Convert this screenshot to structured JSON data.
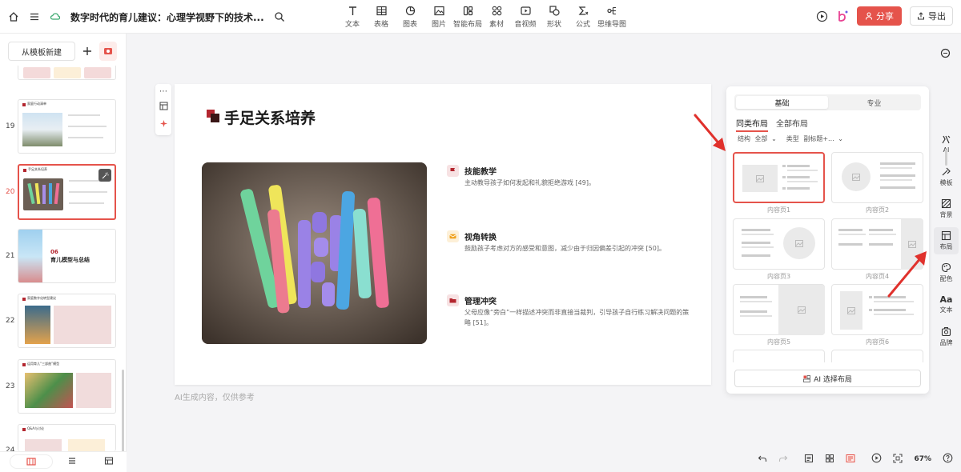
{
  "header": {
    "doc_title": "数字时代的育儿建议：心理学视野下的技术...",
    "share_label": "分享",
    "export_label": "导出"
  },
  "toolbar": [
    {
      "label": "文本",
      "icon": "text-icon"
    },
    {
      "label": "表格",
      "icon": "table-icon"
    },
    {
      "label": "图表",
      "icon": "chart-icon"
    },
    {
      "label": "图片",
      "icon": "image-icon"
    },
    {
      "label": "智能布局",
      "icon": "smart-layout-icon"
    },
    {
      "label": "素材",
      "icon": "material-icon"
    },
    {
      "label": "音视频",
      "icon": "video-icon"
    },
    {
      "label": "形状",
      "icon": "shape-icon"
    },
    {
      "label": "公式",
      "icon": "formula-icon"
    },
    {
      "label": "思维导图",
      "icon": "mindmap-icon"
    }
  ],
  "left_panel": {
    "template_button": "从模板新建",
    "slides": [
      {
        "number": "19",
        "title": "家庭行动清单"
      },
      {
        "number": "20",
        "title": "手足关系培养"
      },
      {
        "number": "21",
        "section": "06",
        "title": "育儿模型与总结"
      },
      {
        "number": "22",
        "title": "家庭数字化转型建议"
      },
      {
        "number": "23",
        "title": "运用育儿“三部曲”模型"
      },
      {
        "number": "24",
        "title": "Q&A与讨论"
      }
    ]
  },
  "slide": {
    "title": "手足关系培养",
    "points": [
      {
        "title": "技能教学",
        "desc": "主动教导孩子如何发起和礼貌拒绝游戏 [49]。",
        "color": "#b3262f"
      },
      {
        "title": "视角转换",
        "desc": "鼓励孩子考虑对方的感受和意图，减少由于归因偏差引起的冲突 [50]。",
        "color": "#f0a21f"
      },
      {
        "title": "管理冲突",
        "desc": "父母应像“旁白”一样描述冲突而非直接当裁判，引导孩子自行练习解决问题的策略 [51]。",
        "color": "#b3262f"
      }
    ],
    "ai_note": "AI生成内容，仅供参考"
  },
  "layout_panel": {
    "segments": [
      "基础",
      "专业"
    ],
    "subtabs": [
      "同类布局",
      "全部布局"
    ],
    "filters": [
      {
        "label": "结构",
        "value": "全部"
      },
      {
        "label": "类型",
        "value": "副标题+..."
      }
    ],
    "cards": [
      "内容页1",
      "内容页2",
      "内容页3",
      "内容页4",
      "内容页5",
      "内容页6"
    ],
    "ai_button": "AI 选择布局"
  },
  "right_rail": [
    {
      "label": "AI",
      "icon": "ai-icon"
    },
    {
      "label": "模板",
      "icon": "template-icon"
    },
    {
      "label": "背景",
      "icon": "background-icon"
    },
    {
      "label": "布局",
      "icon": "layout-icon",
      "active": true
    },
    {
      "label": "配色",
      "icon": "palette-icon"
    },
    {
      "label": "文本",
      "icon": "text-style-icon",
      "glyph": "Aa"
    },
    {
      "label": "品牌",
      "icon": "brand-icon"
    }
  ],
  "footer": {
    "zoom": "67%"
  },
  "colors": {
    "accent": "#e5534b",
    "brand_red": "#b3262f"
  }
}
